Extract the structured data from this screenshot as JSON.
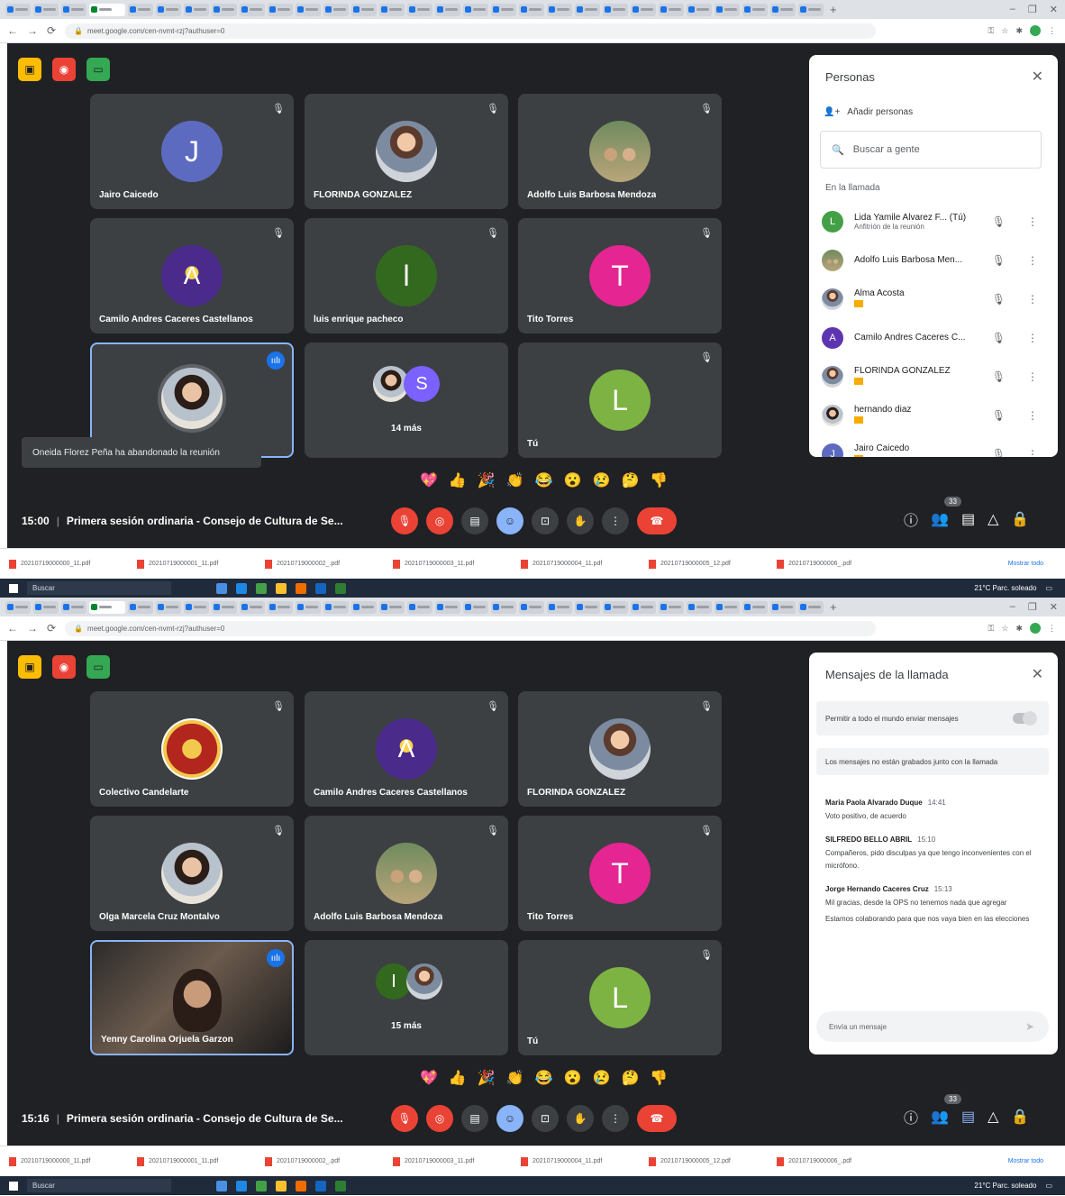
{
  "screens": [
    {
      "browser": {
        "url": "meet.google.com/cen-nvmt-rzj?authuser=0"
      },
      "meeting": {
        "time": "15:00",
        "title": "Primera sesión ordinaria - Consejo de Cultura de Se...",
        "participants_badge": "33"
      },
      "tiles": [
        {
          "name": "Jairo Caicedo",
          "initial": "J",
          "color": "#5c6bc0"
        },
        {
          "name": "FLORINDA GONZALEZ"
        },
        {
          "name": "Adolfo Luis Barbosa Mendoza"
        },
        {
          "name": "Camilo Andres Caceres Castellanos"
        },
        {
          "name": "luis enrique pacheco",
          "initial": "l",
          "color": "#33691e"
        },
        {
          "name": "Tito Torres",
          "initial": "T",
          "color": "#e52592"
        },
        {
          "name": ""
        },
        {
          "more_initial": "S",
          "more_color": "#7b61ff",
          "more_label": "14 más"
        },
        {
          "name": "Tú",
          "initial": "L",
          "color": "#7cb342"
        }
      ],
      "toast": "Oneida Florez Peña ha abandonado la reunión",
      "panel": {
        "title": "Personas",
        "add_label": "Añadir personas",
        "search_placeholder": "Buscar a gente",
        "section_label": "En la llamada",
        "people": [
          {
            "name": "Lida Yamile Alvarez F...  (Tú)",
            "subtitle": "Anfitrión de la reunión",
            "initial": "L",
            "color": "#43a047"
          },
          {
            "name": "Adolfo Luis Barbosa Men...",
            "subtitle": ""
          },
          {
            "name": "Alma Acosta",
            "subtitle": ""
          },
          {
            "name": "Camilo Andres Caceres C...",
            "subtitle": "",
            "initial": "A",
            "color": "#5e35b1"
          },
          {
            "name": "FLORINDA GONZALEZ",
            "subtitle": ""
          },
          {
            "name": "hernando diaz",
            "subtitle": ""
          },
          {
            "name": "Jairo Caicedo",
            "subtitle": "",
            "initial": "J",
            "color": "#5c6bc0"
          }
        ]
      }
    },
    {
      "browser": {
        "url": "meet.google.com/cen-nvmt-rzj?authuser=0"
      },
      "meeting": {
        "time": "15:16",
        "title": "Primera sesión ordinaria - Consejo de Cultura de Se...",
        "participants_badge": "33"
      },
      "tiles": [
        {
          "name": "Colectivo Candelarte"
        },
        {
          "name": "Camilo Andres Caceres Castellanos"
        },
        {
          "name": "FLORINDA GONZALEZ"
        },
        {
          "name": "Olga Marcela Cruz Montalvo"
        },
        {
          "name": "Adolfo Luis Barbosa Mendoza"
        },
        {
          "name": "Tito Torres",
          "initial": "T",
          "color": "#e52592"
        },
        {
          "name": "Yenny Carolina Orjuela Garzon"
        },
        {
          "more_initial": "I",
          "more_color": "#33691e",
          "more_label": "15 más"
        },
        {
          "name": "Tú",
          "initial": "L",
          "color": "#7cb342"
        }
      ],
      "panel": {
        "title": "Mensajes de la llamada",
        "toggle_label": "Permitir a todo el mundo enviar mensajes",
        "notice": "Los mensajes no están grabados junto con la llamada",
        "messages": [
          {
            "sender": "Maria Paola Alvarado Duque",
            "time": "14:41",
            "text": "Voto positivo, de acuerdo"
          },
          {
            "sender": "SILFREDO BELLO ABRIL",
            "time": "15:10",
            "text": "Compañeros, pido disculpas ya que tengo inconvenientes con el micrófono."
          },
          {
            "sender": "Jorge Hernando Caceres Cruz",
            "time": "15:13",
            "text": "Mil gracias, desde la OPS no tenemos nada que agregar"
          },
          {
            "sender": "",
            "time": "",
            "text": "Estamos colaborando para que nos vaya bien en las elecciones"
          }
        ],
        "input_placeholder": "Envía un mensaje"
      }
    }
  ],
  "reactions": [
    "💖",
    "👍",
    "🎉",
    "👏",
    "😂",
    "😮",
    "😢",
    "🤔",
    "👎"
  ],
  "downloads": [
    "20210719000000_11.pdf",
    "20210719000001_11.pdf",
    "20210719000002_.pdf",
    "20210719000003_11.pdf",
    "20210719000004_11.pdf",
    "20210719000005_12.pdf",
    "20210719000006_.pdf"
  ],
  "downloads_showall": "Mostrar todo",
  "taskbar": {
    "search": "Buscar",
    "weather": "21°C  Parc. soleado"
  }
}
